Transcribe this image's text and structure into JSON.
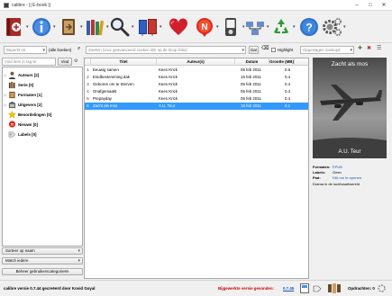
{
  "window": {
    "title": "calibre - || E-book ||",
    "controls": [
      "–",
      "□",
      "✕"
    ]
  },
  "toolbar": {
    "buttons": [
      {
        "name": "add-books",
        "icon": "add-book-icon",
        "dropdown": true
      },
      {
        "name": "edit-metadata",
        "icon": "info-icon",
        "dropdown": true
      },
      {
        "name": "convert-books",
        "icon": "convert-book-icon",
        "dropdown": true
      },
      {
        "name": "view",
        "icon": "view-books-icon",
        "dropdown": true
      },
      {
        "name": "search",
        "icon": "magnifier-icon",
        "dropdown": true
      },
      {
        "name": "store",
        "icon": "store-icon",
        "dropdown": true
      },
      {
        "name": "donate",
        "icon": "heart-icon",
        "dropdown": false
      },
      {
        "name": "news",
        "icon": "news-icon",
        "dropdown": true
      },
      {
        "name": "device",
        "icon": "device-icon",
        "dropdown": true
      },
      {
        "name": "library",
        "icon": "library-icon",
        "dropdown": true
      },
      {
        "name": "remove",
        "icon": "recycle-icon",
        "dropdown": true
      },
      {
        "name": "help",
        "icon": "help-icon",
        "dropdown": false
      },
      {
        "name": "preferences",
        "icon": "gear-icon",
        "dropdown": true
      }
    ]
  },
  "searchbar": {
    "virtual_library": "Beperkt tot",
    "all_books": "(alle boeken)",
    "search_placeholder": "Zoeken (voor geavanceerd zoeken klik op de knop links)",
    "go_label": "Ga!",
    "highlight_label": "Highlight",
    "saved_search_placeholder": "Opgeslagen zoekopd"
  },
  "tag_browser": {
    "find_placeholder": "Vind item in tag-br",
    "find_button": "Vind",
    "nodes": [
      {
        "label": "Auteurs [2]",
        "icon": "authors-icon",
        "arrow": true
      },
      {
        "label": "Serie [0]",
        "icon": "series-icon",
        "arrow": false
      },
      {
        "label": "Formaten [1]",
        "icon": "formats-icon",
        "arrow": true
      },
      {
        "label": "Uitgevers [2]",
        "icon": "publishers-icon",
        "arrow": true
      },
      {
        "label": "Beoordelingen [0]",
        "icon": "star-icon",
        "arrow": false
      },
      {
        "label": "Nieuws [0]",
        "icon": "news-icon",
        "arrow": false
      },
      {
        "label": "Labels [0]",
        "icon": "tag-icon",
        "arrow": false
      }
    ],
    "sort_label": "Sorteer op naam",
    "match_label": "Match iedere",
    "manage_label": "Beheer gebruikerscategorieën"
  },
  "booklist": {
    "columns": [
      "Titel",
      "Auteur(s)",
      "Datum",
      "Grootte (MB)"
    ],
    "rows": [
      {
        "num": "1",
        "title": "Eeuwig samen",
        "author": "Kees Krick",
        "date": "05 feb 2011",
        "size": "0.6",
        "selected": false
      },
      {
        "num": "2",
        "title": "Eindbestemming dak",
        "author": "Kees Krick",
        "date": "15 feb 2011",
        "size": "0.4",
        "selected": false
      },
      {
        "num": "3",
        "title": "Geboren om te Sterven",
        "author": "Kees Krick",
        "date": "05 feb 2011",
        "size": "0.4",
        "selected": false
      },
      {
        "num": "4",
        "title": "Onafgemaakt",
        "author": "Kees Krick",
        "date": "05 feb 2011",
        "size": "0.4",
        "selected": false
      },
      {
        "num": "5",
        "title": "Prepayday",
        "author": "Kees Krick",
        "date": "05 feb 2011",
        "size": "0.4",
        "selected": false
      },
      {
        "num": "6",
        "title": "Zacht als mos",
        "author": "A.U. Teur",
        "date": "15 feb 2011",
        "size": "0.1",
        "selected": true
      }
    ]
  },
  "details": {
    "cover_title": "Zacht als mos",
    "cover_author": "A.U. Teur",
    "formats_label": "Formaten:",
    "formats_value": "EPUB",
    "labels_label": "Labels:",
    "labels_value": "Geen",
    "path_label": "Pad:",
    "path_value": "Klik om te openen",
    "comment": "Drama in de luchtvaartwereld"
  },
  "statusbar": {
    "version": "calibre versie 0.7.44 gecreëerd door Kovid Goyal",
    "update_label": "Bijgewerkte versie gevonden:",
    "update_version": "0.7.45",
    "jobs": "Opdrachten: 0"
  }
}
